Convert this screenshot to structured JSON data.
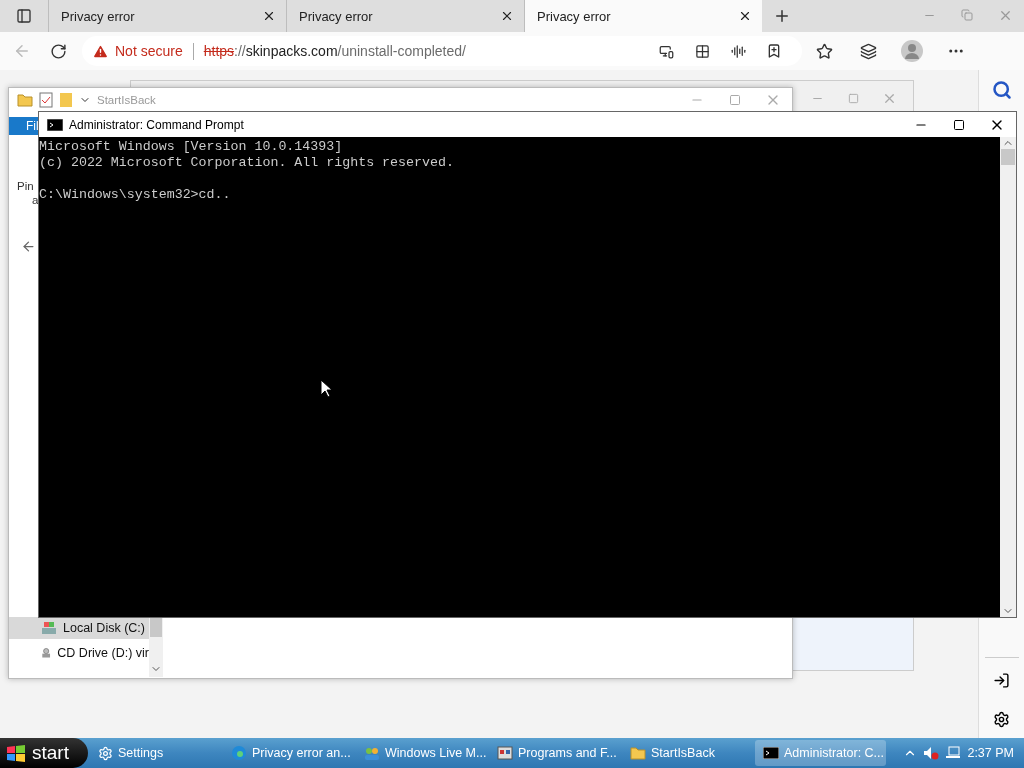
{
  "browser": {
    "tabs": [
      {
        "title": "Privacy error",
        "selected": false
      },
      {
        "title": "Privacy error",
        "selected": false
      },
      {
        "title": "Privacy error",
        "selected": true
      }
    ],
    "address": {
      "security": "Not secure",
      "scheme": "https",
      "separator": "://",
      "host": "skinpacks.com",
      "path": "/uninstall-completed/"
    }
  },
  "explorer": {
    "title": "StartIsBack",
    "ribbon_tab": "Fil",
    "pin_text": "Pin",
    "pin_text_2": "a",
    "nav_items": [
      {
        "label": "Local Disk (C:)",
        "selected": true,
        "kind": "disk"
      },
      {
        "label": "CD Drive (D:) vir",
        "selected": false,
        "kind": "cd"
      }
    ]
  },
  "command_prompt": {
    "title": "Administrator: Command Prompt",
    "lines": [
      "Microsoft Windows [Version 10.0.14393]",
      "(c) 2022 Microsoft Corporation. All rights reserved."
    ],
    "prompt": "C:\\Windows\\system32>cd.."
  },
  "taskbar": {
    "start": "start",
    "items": [
      {
        "label": "Settings",
        "kind": "gear",
        "selected": false
      },
      {
        "label": "Privacy error an...",
        "kind": "browser",
        "selected": false
      },
      {
        "label": "Windows Live M...",
        "kind": "people",
        "selected": false
      },
      {
        "label": "Programs and F...",
        "kind": "programs",
        "selected": false
      },
      {
        "label": "StartIsBack",
        "kind": "folder",
        "selected": false
      },
      {
        "label": "Administrator: C...",
        "kind": "console",
        "selected": true
      }
    ],
    "clock": "2:37 PM"
  }
}
